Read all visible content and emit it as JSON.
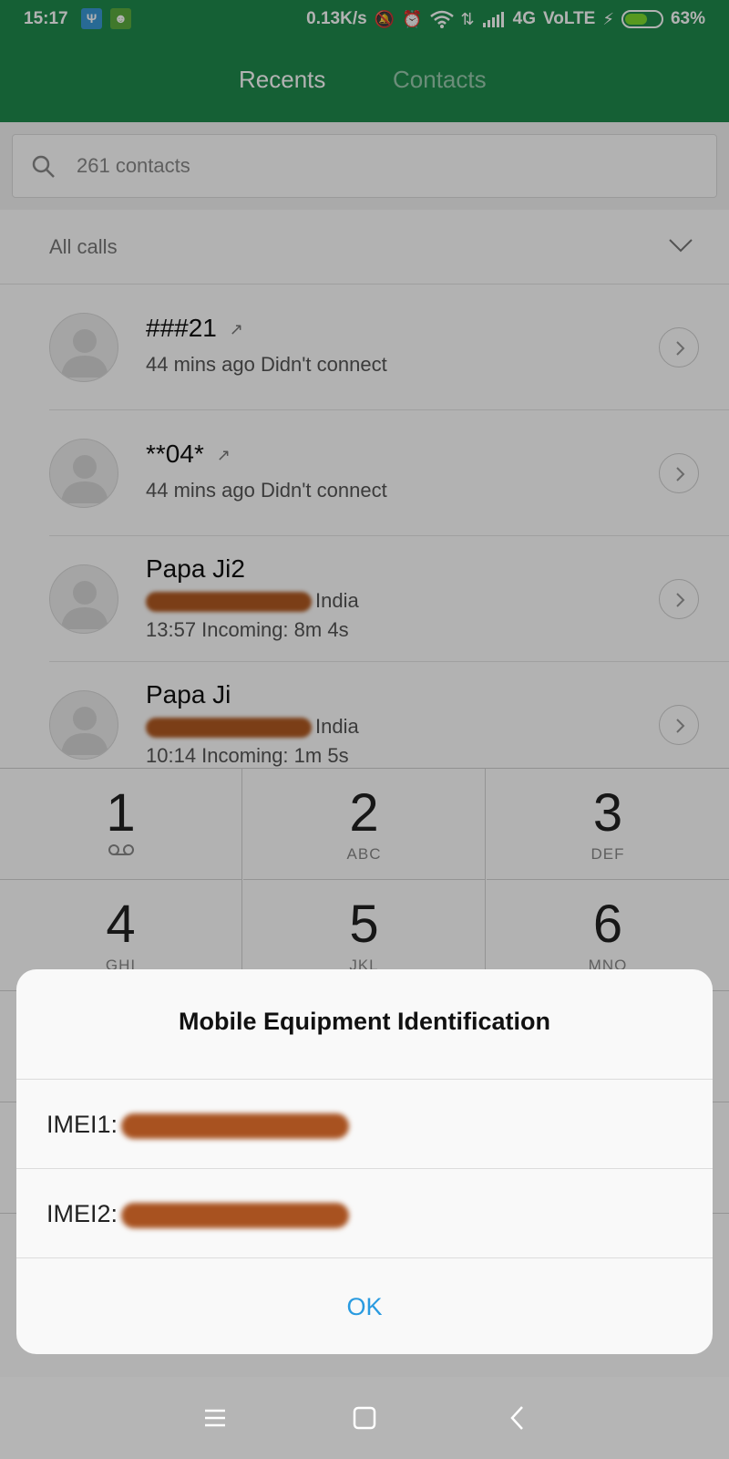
{
  "status_bar": {
    "time": "15:17",
    "net_speed": "0.13K/s",
    "network": "4G",
    "volte": "VoLTE",
    "battery": "63%",
    "battery_level_fraction": 0.63,
    "icons": [
      "usb-icon",
      "android-debug-icon",
      "mute-icon",
      "alarm-icon",
      "wifi-icon",
      "data-arrows-icon",
      "signal-icon",
      "charging-icon",
      "battery-icon"
    ]
  },
  "header": {
    "tabs": [
      {
        "label": "Recents",
        "active": true
      },
      {
        "label": "Contacts",
        "active": false
      }
    ]
  },
  "search": {
    "placeholder": "261 contacts"
  },
  "filter": {
    "label": "All calls"
  },
  "calls": [
    {
      "name": "###21",
      "line1": "44 mins ago Didn't connect",
      "outgoing": true
    },
    {
      "name": "**04*",
      "line1": "44 mins ago Didn't connect",
      "outgoing": true
    },
    {
      "name": "Papa Ji2",
      "region": "India",
      "line2": "13:57 Incoming: 8m 4s"
    },
    {
      "name": "Papa Ji",
      "region": "India",
      "line2": "10:14 Incoming: 1m 5s"
    }
  ],
  "dialpad": {
    "keys": [
      {
        "num": "1",
        "sub": ""
      },
      {
        "num": "2",
        "sub": "ABC"
      },
      {
        "num": "3",
        "sub": "DEF"
      },
      {
        "num": "4",
        "sub": "GHI"
      },
      {
        "num": "5",
        "sub": "JKL"
      },
      {
        "num": "6",
        "sub": "MNO"
      }
    ]
  },
  "dialog": {
    "title": "Mobile Equipment Identification",
    "imei1_label": "IMEI1:",
    "imei2_label": "IMEI2:",
    "ok_label": "OK"
  },
  "colors": {
    "header_green": "#1f8a4c",
    "ok_blue": "#2a9be0",
    "redaction_brown": "#b15a22"
  }
}
